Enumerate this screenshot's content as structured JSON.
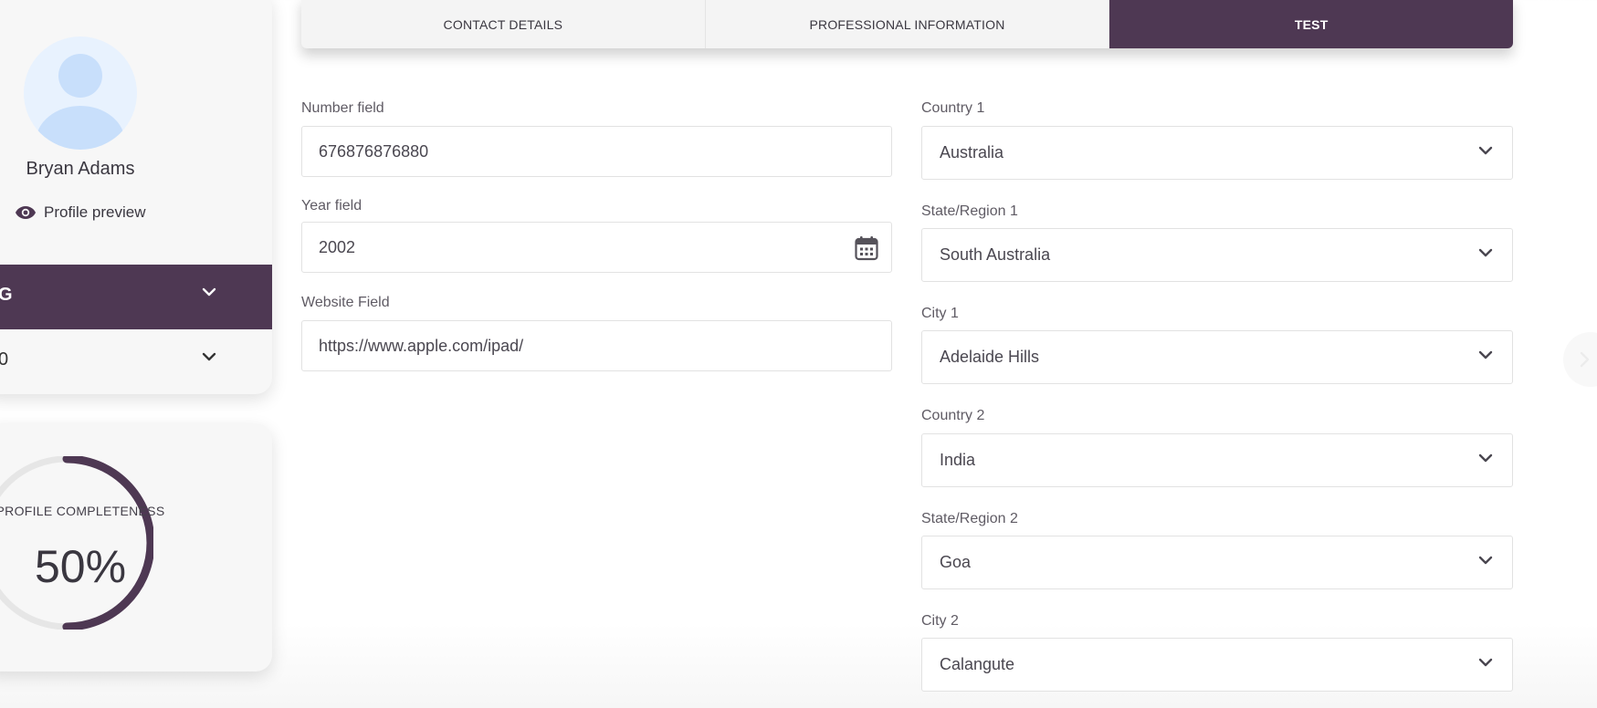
{
  "profile": {
    "name": "Bryan Adams",
    "preview_label": "Profile preview",
    "accordion_active_label": "G",
    "accordion_label": "0"
  },
  "completeness": {
    "title": "PROFILE COMPLETENESS",
    "value_text": "50%",
    "percent": 50
  },
  "tabs": [
    {
      "label": "CONTACT DETAILS",
      "active": false
    },
    {
      "label": "PROFESSIONAL INFORMATION",
      "active": false
    },
    {
      "label": "TEST",
      "active": true
    }
  ],
  "form": {
    "number_field": {
      "label": "Number field",
      "value": "676876876880"
    },
    "year_field": {
      "label": "Year field",
      "value": "2002"
    },
    "website_field": {
      "label": "Website Field",
      "value": "https://www.apple.com/ipad/"
    },
    "country1": {
      "label": "Country 1",
      "value": "Australia"
    },
    "state1": {
      "label": "State/Region 1",
      "value": "South Australia"
    },
    "city1": {
      "label": "City 1",
      "value": "Adelaide Hills"
    },
    "country2": {
      "label": "Country 2",
      "value": "India"
    },
    "state2": {
      "label": "State/Region 2",
      "value": "Goa"
    },
    "city2": {
      "label": "City 2",
      "value": "Calangute"
    }
  },
  "colors": {
    "accent": "#4e3853",
    "ring_track": "#e6e6e6"
  }
}
